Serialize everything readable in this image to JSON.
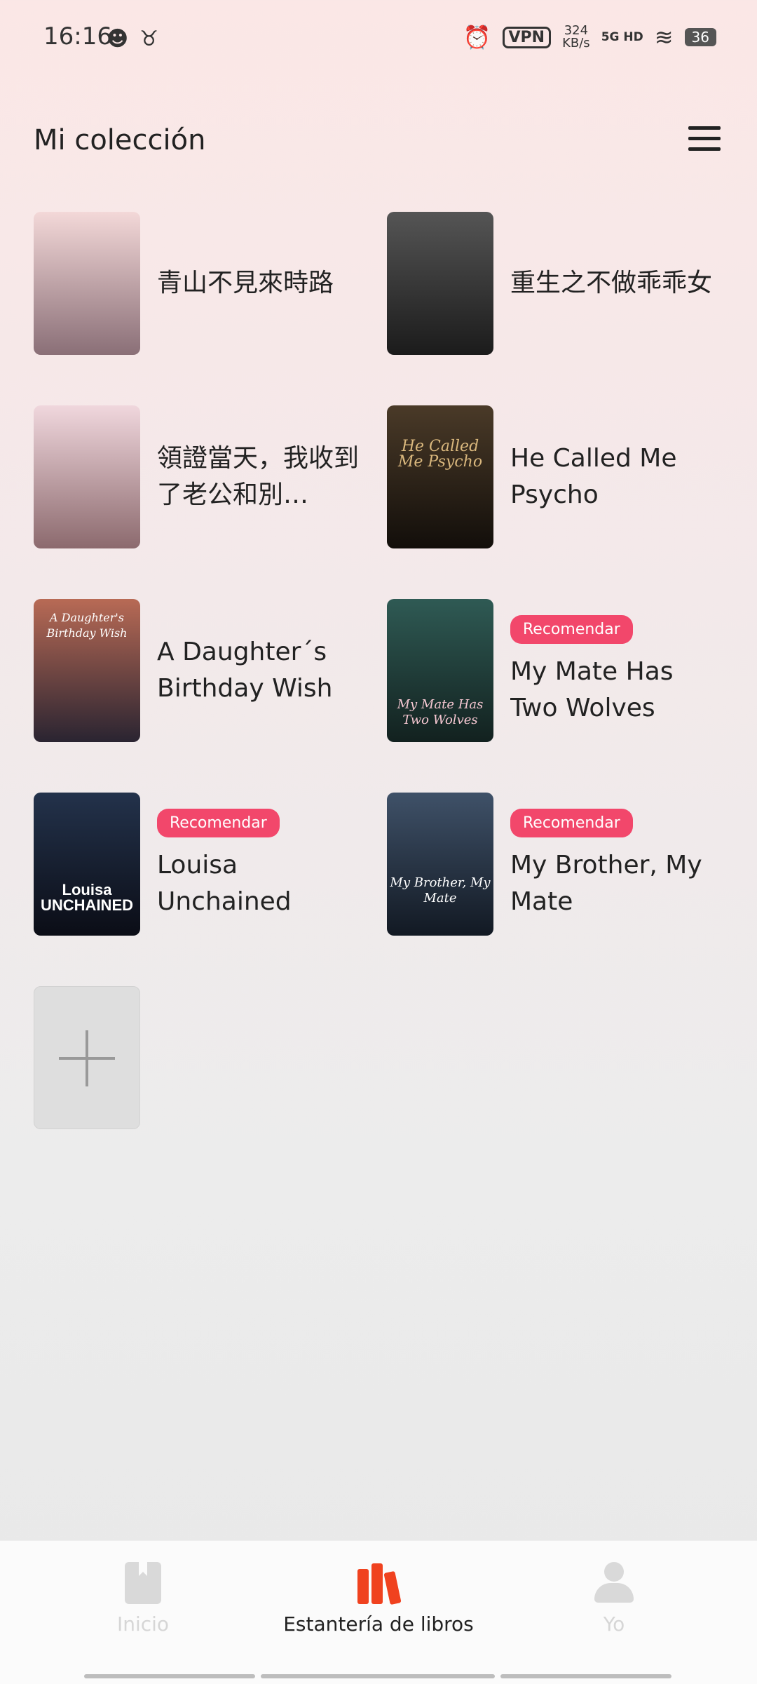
{
  "status_bar": {
    "time": "16:16",
    "left_icons": [
      "wechat-icon",
      "cow-icon"
    ],
    "vpn": "VPN",
    "speed_value": "324",
    "speed_unit": "KB/s",
    "network": "5G HD",
    "battery": "36"
  },
  "header": {
    "title": "Mi colección",
    "menu_icon": "hamburger-menu-icon"
  },
  "books": [
    {
      "title": "青山不見來時路",
      "badge": "",
      "cover_text": "",
      "cover_colors": [
        "#f3d8d8",
        "#8a6f77"
      ]
    },
    {
      "title": "重生之不做乖乖女",
      "badge": "",
      "cover_text": "",
      "cover_colors": [
        "#555",
        "#1b1b1b"
      ]
    },
    {
      "title": "領證當天，我收到了老公和別…",
      "badge": "",
      "cover_text": "",
      "cover_colors": [
        "#f0d7dd",
        "#8c6a6e"
      ]
    },
    {
      "title": "He Called Me Psycho",
      "badge": "",
      "cover_text": "He Called Me Psycho",
      "cover_colors": [
        "#4a3a28",
        "#120e0a"
      ]
    },
    {
      "title": "A Daughter´s Birthday Wish",
      "badge": "",
      "cover_text": "A Daughter's Birthday Wish",
      "cover_colors": [
        "#b86a55",
        "#2a2431"
      ]
    },
    {
      "title": "My Mate Has Two Wolves",
      "badge": "Recomendar",
      "cover_text": "My Mate Has Two Wolves",
      "cover_colors": [
        "#2f5a54",
        "#12211f"
      ]
    },
    {
      "title": "Louisa Unchained",
      "badge": "Recomendar",
      "cover_text": "Louisa UNCHAINED",
      "cover_colors": [
        "#23324b",
        "#0b0d16"
      ]
    },
    {
      "title": "My Brother, My Mate",
      "badge": "Recomendar",
      "cover_text": "My Brother, My Mate",
      "cover_colors": [
        "#3f5168",
        "#121923"
      ]
    }
  ],
  "add_tile_icon": "plus-icon",
  "tabs": [
    {
      "label": "Inicio",
      "icon": "book-icon",
      "active": false
    },
    {
      "label": "Estantería de libros",
      "icon": "bookshelf-icon",
      "active": true
    },
    {
      "label": "Yo",
      "icon": "person-icon",
      "active": false
    }
  ],
  "colors": {
    "accent": "#f2476b",
    "active_tab_icon": "#f0421f"
  }
}
